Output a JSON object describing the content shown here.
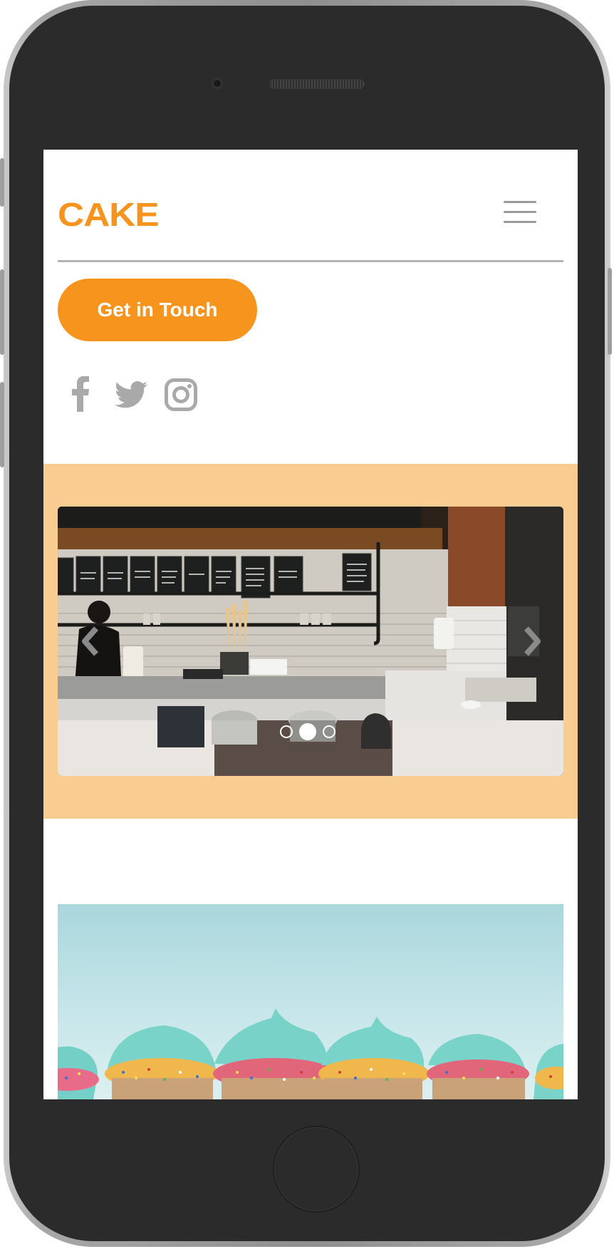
{
  "brand": {
    "logo_text": "CAKE",
    "accent": "#f7941d",
    "band_color": "#f9cc92"
  },
  "header": {
    "menu_icon": "hamburger-menu-icon"
  },
  "cta": {
    "label": "Get in Touch"
  },
  "social": [
    "facebook-icon",
    "twitter-icon",
    "instagram-icon"
  ],
  "carousel": {
    "slide_count": 3,
    "active_index": 1,
    "prev_icon": "chevron-left-icon",
    "next_icon": "chevron-right-icon",
    "menu_boards": [
      "milk chocolate",
      "Tahitian Vanilla",
      "toasted coconut",
      "Pecan Cinnamon Swirl",
      "Raspberry",
      "Matcha Green Tea",
      "Sour Cherry Goat Cheese",
      "Salted Chocolate",
      "ask about our vegan flavours"
    ]
  }
}
